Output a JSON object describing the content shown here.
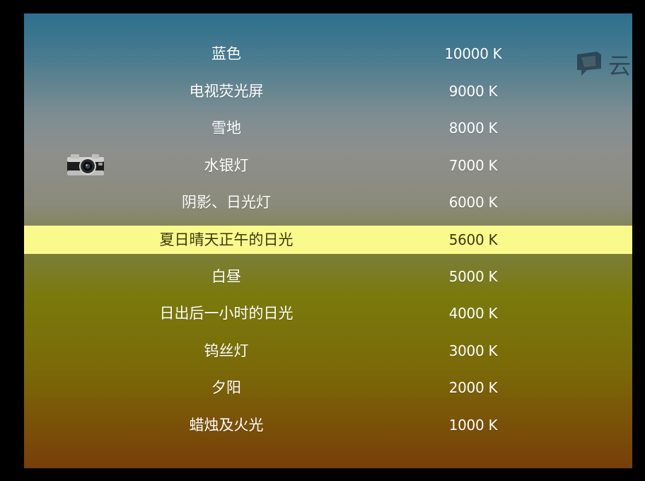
{
  "table": {
    "rows": [
      {
        "name": "蓝色",
        "temp": "10000 K"
      },
      {
        "name": "电视荧光屏",
        "temp": "9000 K"
      },
      {
        "name": "雪地",
        "temp": "8000 K"
      },
      {
        "name": "水银灯",
        "temp": "7000 K"
      },
      {
        "name": "阴影、日光灯",
        "temp": "6000 K"
      },
      {
        "name": "夏日晴天正午的日光",
        "temp": "5600 K"
      },
      {
        "name": "白昼",
        "temp": "5000 K"
      },
      {
        "name": "日出后一小时的日光",
        "temp": "4000 K"
      },
      {
        "name": "钨丝灯",
        "temp": "3000 K"
      },
      {
        "name": "夕阳",
        "temp": "2000 K"
      },
      {
        "name": "蜡烛及火光",
        "temp": "1000 K"
      }
    ],
    "highlighted_row": "夏日晴天正午的日光",
    "highlight_color": "#fafa8c"
  },
  "icons": {
    "camera": "camera-icon",
    "watermark": "speech-bubble-icon"
  },
  "watermark": {
    "text": "云"
  }
}
